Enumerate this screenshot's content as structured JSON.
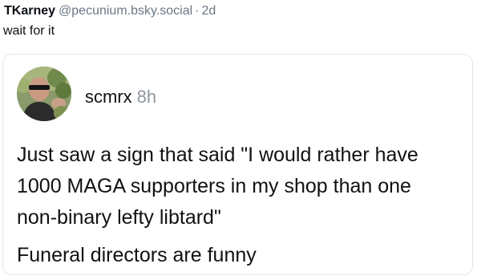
{
  "post": {
    "author_name": "TKarney",
    "author_handle": "@pecunium.bsky.social",
    "separator": "·",
    "time": "2d",
    "text": "wait for it"
  },
  "quote": {
    "avatar_icon": "avatar-photo-icon",
    "username": "scmrx",
    "time": "8h",
    "body_lines": [
      "Just saw a sign that said \"I would rather have",
      "1000 MAGA supporters in my shop than one",
      "non-binary lefty libtard\""
    ],
    "body_paragraph2": "Funeral directors are funny"
  }
}
